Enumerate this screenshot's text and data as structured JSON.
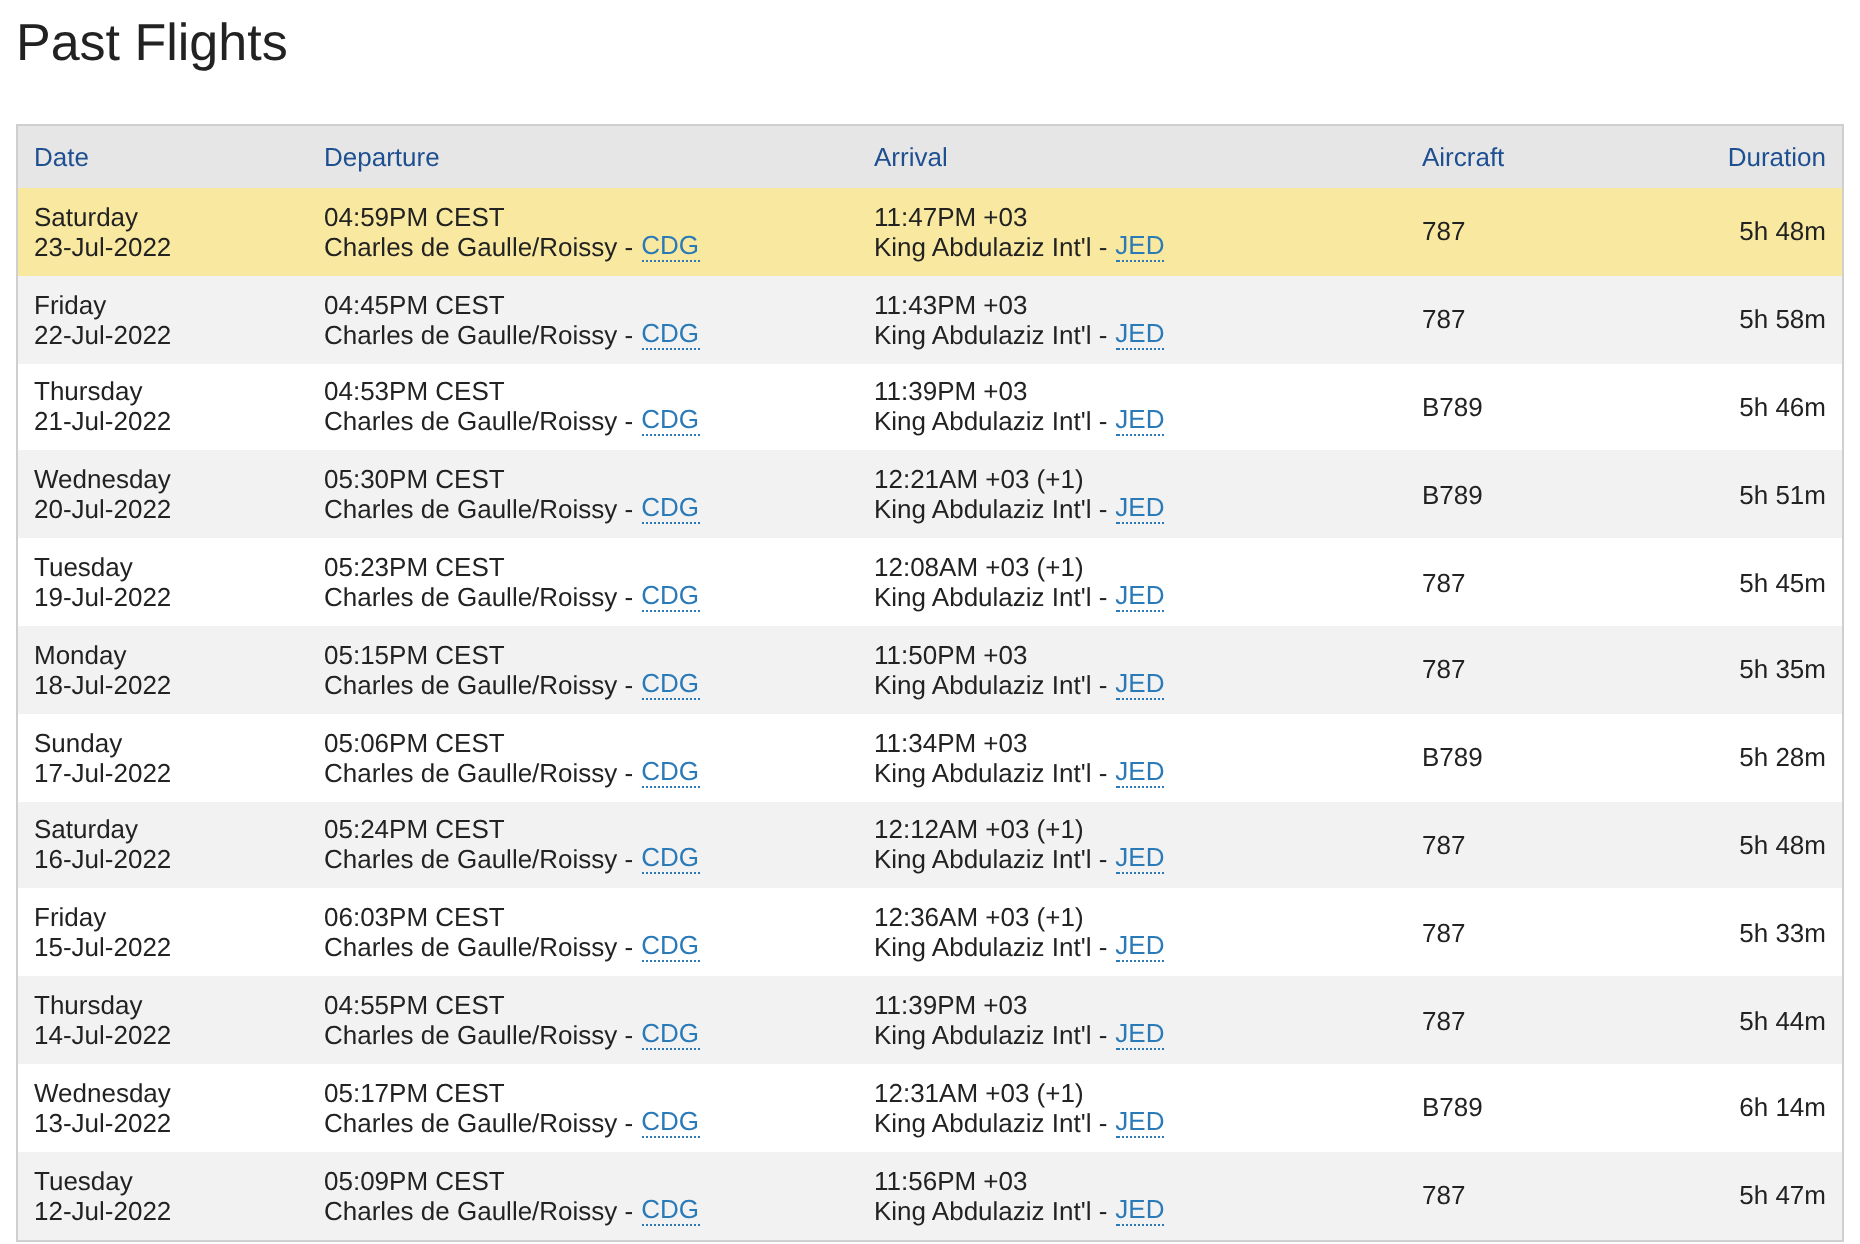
{
  "title": "Past Flights",
  "table": {
    "columns": [
      "Date",
      "Departure",
      "Arrival",
      "Aircraft",
      "Duration"
    ],
    "rows": [
      {
        "selected": true,
        "weekday": "Saturday",
        "date": "23-Jul-2022",
        "dep_time": "04:59PM CEST",
        "dep_airport": "Charles de Gaulle/Roissy -",
        "dep_code": "CDG",
        "arr_time": "11:47PM +03",
        "arr_airport": "King Abdulaziz Int'l -",
        "arr_code": "JED",
        "aircraft": "787",
        "duration": "5h 48m"
      },
      {
        "selected": false,
        "weekday": "Friday",
        "date": "22-Jul-2022",
        "dep_time": "04:45PM CEST",
        "dep_airport": "Charles de Gaulle/Roissy -",
        "dep_code": "CDG",
        "arr_time": "11:43PM +03",
        "arr_airport": "King Abdulaziz Int'l -",
        "arr_code": "JED",
        "aircraft": "787",
        "duration": "5h 58m"
      },
      {
        "selected": false,
        "weekday": "Thursday",
        "date": "21-Jul-2022",
        "dep_time": "04:53PM CEST",
        "dep_airport": "Charles de Gaulle/Roissy -",
        "dep_code": "CDG",
        "arr_time": "11:39PM +03",
        "arr_airport": "King Abdulaziz Int'l -",
        "arr_code": "JED",
        "aircraft": "B789",
        "duration": "5h 46m"
      },
      {
        "selected": false,
        "weekday": "Wednesday",
        "date": "20-Jul-2022",
        "dep_time": "05:30PM CEST",
        "dep_airport": "Charles de Gaulle/Roissy -",
        "dep_code": "CDG",
        "arr_time": "12:21AM +03 (+1)",
        "arr_airport": "King Abdulaziz Int'l -",
        "arr_code": "JED",
        "aircraft": "B789",
        "duration": "5h 51m"
      },
      {
        "selected": false,
        "weekday": "Tuesday",
        "date": "19-Jul-2022",
        "dep_time": "05:23PM CEST",
        "dep_airport": "Charles de Gaulle/Roissy -",
        "dep_code": "CDG",
        "arr_time": "12:08AM +03 (+1)",
        "arr_airport": "King Abdulaziz Int'l -",
        "arr_code": "JED",
        "aircraft": "787",
        "duration": "5h 45m"
      },
      {
        "selected": false,
        "weekday": "Monday",
        "date": "18-Jul-2022",
        "dep_time": "05:15PM CEST",
        "dep_airport": "Charles de Gaulle/Roissy -",
        "dep_code": "CDG",
        "arr_time": "11:50PM +03",
        "arr_airport": "King Abdulaziz Int'l -",
        "arr_code": "JED",
        "aircraft": "787",
        "duration": "5h 35m"
      },
      {
        "selected": false,
        "weekday": "Sunday",
        "date": "17-Jul-2022",
        "dep_time": "05:06PM CEST",
        "dep_airport": "Charles de Gaulle/Roissy -",
        "dep_code": "CDG",
        "arr_time": "11:34PM +03",
        "arr_airport": "King Abdulaziz Int'l -",
        "arr_code": "JED",
        "aircraft": "B789",
        "duration": "5h 28m"
      },
      {
        "selected": false,
        "weekday": "Saturday",
        "date": "16-Jul-2022",
        "dep_time": "05:24PM CEST",
        "dep_airport": "Charles de Gaulle/Roissy -",
        "dep_code": "CDG",
        "arr_time": "12:12AM +03 (+1)",
        "arr_airport": "King Abdulaziz Int'l -",
        "arr_code": "JED",
        "aircraft": "787",
        "duration": "5h 48m"
      },
      {
        "selected": false,
        "weekday": "Friday",
        "date": "15-Jul-2022",
        "dep_time": "06:03PM CEST",
        "dep_airport": "Charles de Gaulle/Roissy -",
        "dep_code": "CDG",
        "arr_time": "12:36AM +03 (+1)",
        "arr_airport": "King Abdulaziz Int'l -",
        "arr_code": "JED",
        "aircraft": "787",
        "duration": "5h 33m"
      },
      {
        "selected": false,
        "weekday": "Thursday",
        "date": "14-Jul-2022",
        "dep_time": "04:55PM CEST",
        "dep_airport": "Charles de Gaulle/Roissy -",
        "dep_code": "CDG",
        "arr_time": "11:39PM +03",
        "arr_airport": "King Abdulaziz Int'l -",
        "arr_code": "JED",
        "aircraft": "787",
        "duration": "5h 44m"
      },
      {
        "selected": false,
        "weekday": "Wednesday",
        "date": "13-Jul-2022",
        "dep_time": "05:17PM CEST",
        "dep_airport": "Charles de Gaulle/Roissy -",
        "dep_code": "CDG",
        "arr_time": "12:31AM +03 (+1)",
        "arr_airport": "King Abdulaziz Int'l -",
        "arr_code": "JED",
        "aircraft": "B789",
        "duration": "6h 14m"
      },
      {
        "selected": false,
        "weekday": "Tuesday",
        "date": "12-Jul-2022",
        "dep_time": "05:09PM CEST",
        "dep_airport": "Charles de Gaulle/Roissy -",
        "dep_code": "CDG",
        "arr_time": "11:56PM +03",
        "arr_airport": "King Abdulaziz Int'l -",
        "arr_code": "JED",
        "aircraft": "787",
        "duration": "5h 47m"
      }
    ]
  }
}
